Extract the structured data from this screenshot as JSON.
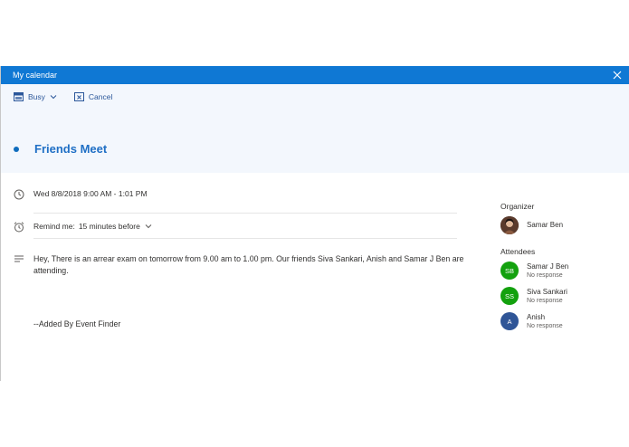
{
  "window": {
    "title": "My calendar"
  },
  "toolbar": {
    "busy_label": "Busy",
    "cancel_label": "Cancel"
  },
  "event": {
    "title": "Friends Meet",
    "datetime": "Wed 8/8/2018 9:00 AM - 1:01 PM",
    "reminder_label": "Remind me:",
    "reminder_value": "15 minutes before",
    "description": "Hey, There is an arrear exam on tomorrow from 9.00 am to 1.00 pm. Our friends Siva Sankari, Anish and Samar J Ben are attending.",
    "footer_note": "--Added By Event Finder"
  },
  "side": {
    "organizer_heading": "Organizer",
    "organizer": {
      "name": "Samar Ben"
    },
    "attendees_heading": "Attendees",
    "attendees": [
      {
        "initials": "SB",
        "name": "Samar J Ben",
        "status": "No response",
        "color": "#13a10e"
      },
      {
        "initials": "SS",
        "name": "Siva Sankari",
        "status": "No response",
        "color": "#13a10e"
      },
      {
        "initials": "A",
        "name": "Anish",
        "status": "No response",
        "color": "#2f5597"
      }
    ]
  },
  "colors": {
    "titlebar": "#0f78d4",
    "accent": "#1f6fc5"
  }
}
